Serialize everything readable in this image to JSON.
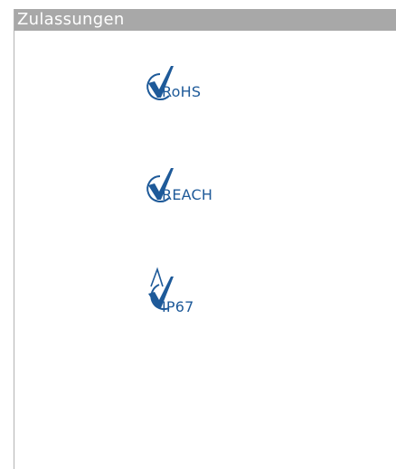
{
  "panel": {
    "title": "Zulassungen"
  },
  "certifications": [
    {
      "label": "RoHS",
      "icon": "rohs-check-icon"
    },
    {
      "label": "REACH",
      "icon": "reach-check-icon"
    },
    {
      "label": "IP67",
      "icon": "ip67-check-icon"
    }
  ],
  "colors": {
    "header_bg": "#a8a8a8",
    "header_text": "#ffffff",
    "icon_blue": "#1e5a99",
    "border": "#b3b3b3"
  }
}
